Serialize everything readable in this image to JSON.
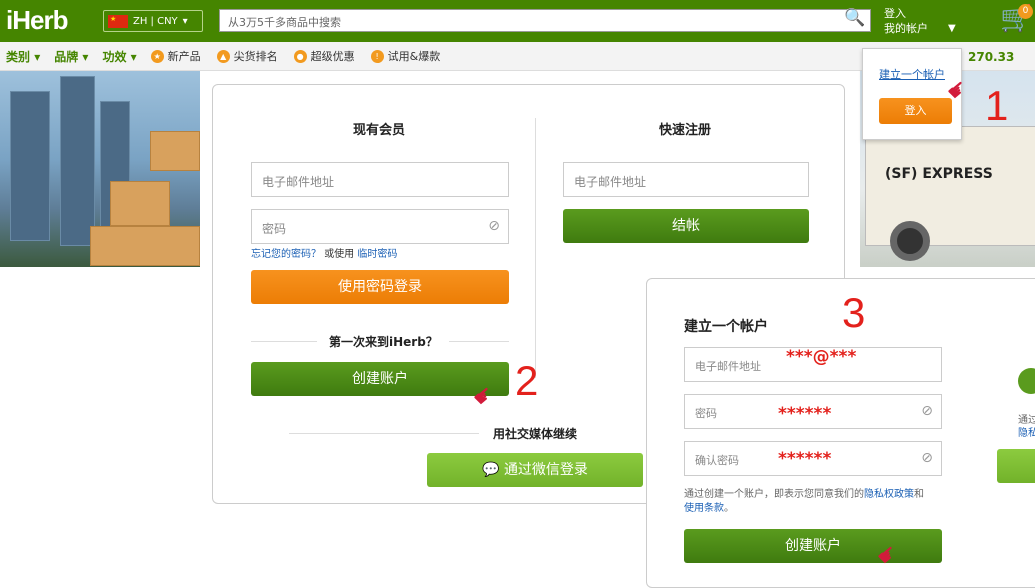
{
  "header": {
    "logo": "iHerb",
    "locale": "ZH | CNY",
    "search_placeholder": "从3万5千多商品中搜索",
    "signin": "登入",
    "my_account": "我的帐户",
    "cart_count": "0"
  },
  "nav": {
    "category": "类别",
    "brand": "品牌",
    "efficacy": "功效",
    "new_products": "新产品",
    "top_ranking": "尖货排名",
    "super_deals": "超级优惠",
    "trial": "试用&爆款",
    "price_fragment": "270.33"
  },
  "dropdown": {
    "create_account": "建立一个帐户",
    "signin_button": "登入"
  },
  "login": {
    "existing_title": "现有会员",
    "email_placeholder": "电子邮件地址",
    "password_placeholder": "密码",
    "forgot": "忘记您的密码？",
    "or_use": "或使用",
    "temp_password": "临时密码",
    "login_button": "使用密码登录",
    "first_time": "第一次来到iHerb？",
    "create_button": "创建账户",
    "social": "用社交媒体继续",
    "wechat_button": "通过微信登录"
  },
  "quick": {
    "title": "快速注册",
    "email_placeholder": "电子邮件地址",
    "checkout_button": "结帐"
  },
  "register": {
    "title": "建立一个帐户",
    "email_placeholder": "电子邮件地址",
    "email_value": "***@***",
    "password_placeholder": "密码",
    "password_value": "******",
    "confirm_placeholder": "确认密码",
    "confirm_value": "******",
    "terms_prefix": "通过创建一个账户，即表示您同意我们的",
    "privacy_link": "隐私权政策",
    "and": "和",
    "terms_link": "使用条款",
    "period": "。",
    "create_button": "创建账户",
    "side_text1": "通过",
    "side_text2": "隐私"
  },
  "annotations": {
    "step1": "1",
    "step2": "2",
    "step3": "3"
  }
}
